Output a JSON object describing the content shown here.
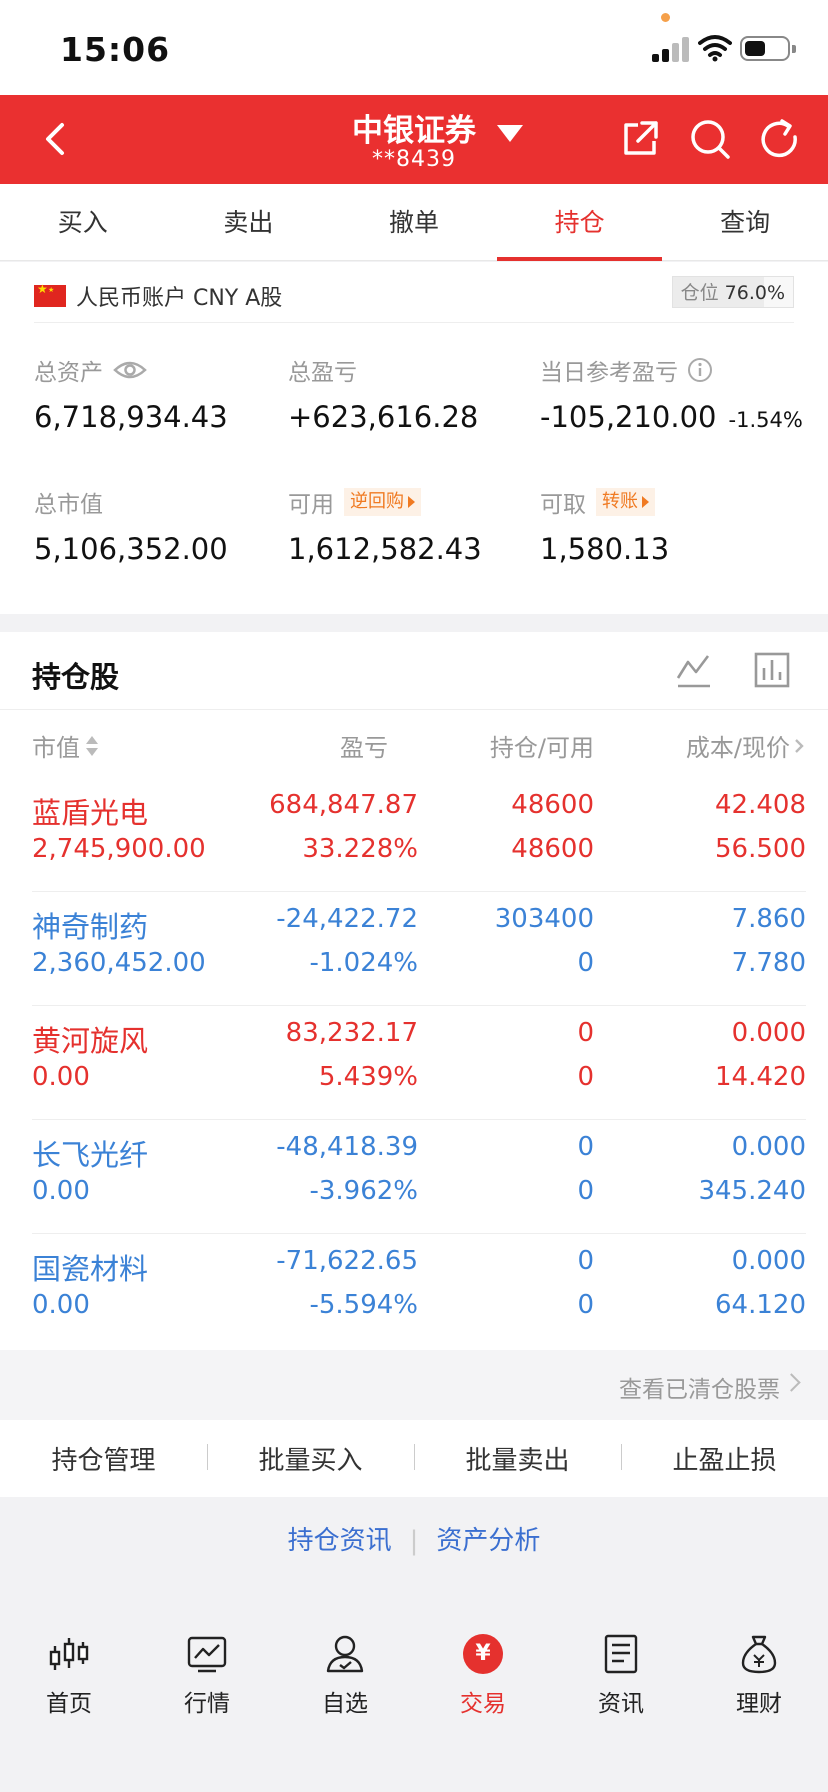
{
  "status": {
    "time": "15:06"
  },
  "header": {
    "title": "中银证券",
    "account": "**8439"
  },
  "tabs": [
    {
      "label": "买入"
    },
    {
      "label": "卖出"
    },
    {
      "label": "撤单"
    },
    {
      "label": "持仓"
    },
    {
      "label": "查询"
    }
  ],
  "active_tab": "持仓",
  "account": {
    "type": "人民币账户 CNY A股",
    "position_label": "仓位",
    "position_pct": "76.0%",
    "position_fraction": 0.76,
    "total_assets_label": "总资产",
    "total_assets": "6,718,934.43",
    "total_pl_label": "总盈亏",
    "total_pl": "+623,616.28",
    "daily_pl_label": "当日参考盈亏",
    "daily_pl": "-105,210.00",
    "daily_pl_pct": "-1.54%",
    "market_value_label": "总市值",
    "market_value": "5,106,352.00",
    "available_label": "可用",
    "available_tag": "逆回购",
    "available": "1,612,582.43",
    "withdrawable_label": "可取",
    "withdrawable_tag": "转账",
    "withdrawable": "1,580.13"
  },
  "holdings": {
    "title": "持仓股",
    "columns": [
      "市值",
      "盈亏",
      "持仓/可用",
      "成本/现价"
    ],
    "rows": [
      {
        "name": "蓝盾光电",
        "market_value": "2,745,900.00",
        "pl": "684,847.87",
        "pl_pct": "33.228%",
        "position": "48600",
        "available": "48600",
        "cost": "42.408",
        "price": "56.500",
        "color": "#e5312e"
      },
      {
        "name": "神奇制药",
        "market_value": "2,360,452.00",
        "pl": "-24,422.72",
        "pl_pct": "-1.024%",
        "position": "303400",
        "available": "0",
        "cost": "7.860",
        "price": "7.780",
        "color": "#3b82d6"
      },
      {
        "name": "黄河旋风",
        "market_value": "0.00",
        "pl": "83,232.17",
        "pl_pct": "5.439%",
        "position": "0",
        "available": "0",
        "cost": "0.000",
        "price": "14.420",
        "color": "#e5312e"
      },
      {
        "name": "长飞光纤",
        "market_value": "0.00",
        "pl": "-48,418.39",
        "pl_pct": "-3.962%",
        "position": "0",
        "available": "0",
        "cost": "0.000",
        "price": "345.240",
        "color": "#3b82d6"
      },
      {
        "name": "国瓷材料",
        "market_value": "0.00",
        "pl": "-71,622.65",
        "pl_pct": "-5.594%",
        "position": "0",
        "available": "0",
        "cost": "0.000",
        "price": "64.120",
        "color": "#3b82d6"
      }
    ],
    "view_cleared": "查看已清仓股票"
  },
  "actions": [
    {
      "label": "持仓管理"
    },
    {
      "label": "批量买入"
    },
    {
      "label": "批量卖出"
    },
    {
      "label": "止盈止损"
    }
  ],
  "links": {
    "news": "持仓资讯",
    "analysis": "资产分析"
  },
  "bottom_nav": [
    {
      "label": "首页",
      "icon": "candlestick-icon"
    },
    {
      "label": "行情",
      "icon": "chart-line-icon"
    },
    {
      "label": "自选",
      "icon": "user-icon"
    },
    {
      "label": "交易",
      "icon": "yen-icon"
    },
    {
      "label": "资讯",
      "icon": "document-icon"
    },
    {
      "label": "理财",
      "icon": "money-bag-icon"
    }
  ],
  "colors": {
    "brand_red": "#ea3030",
    "up": "#e5312e",
    "down": "#3b82d6",
    "tag_orange": "#f07a22"
  }
}
